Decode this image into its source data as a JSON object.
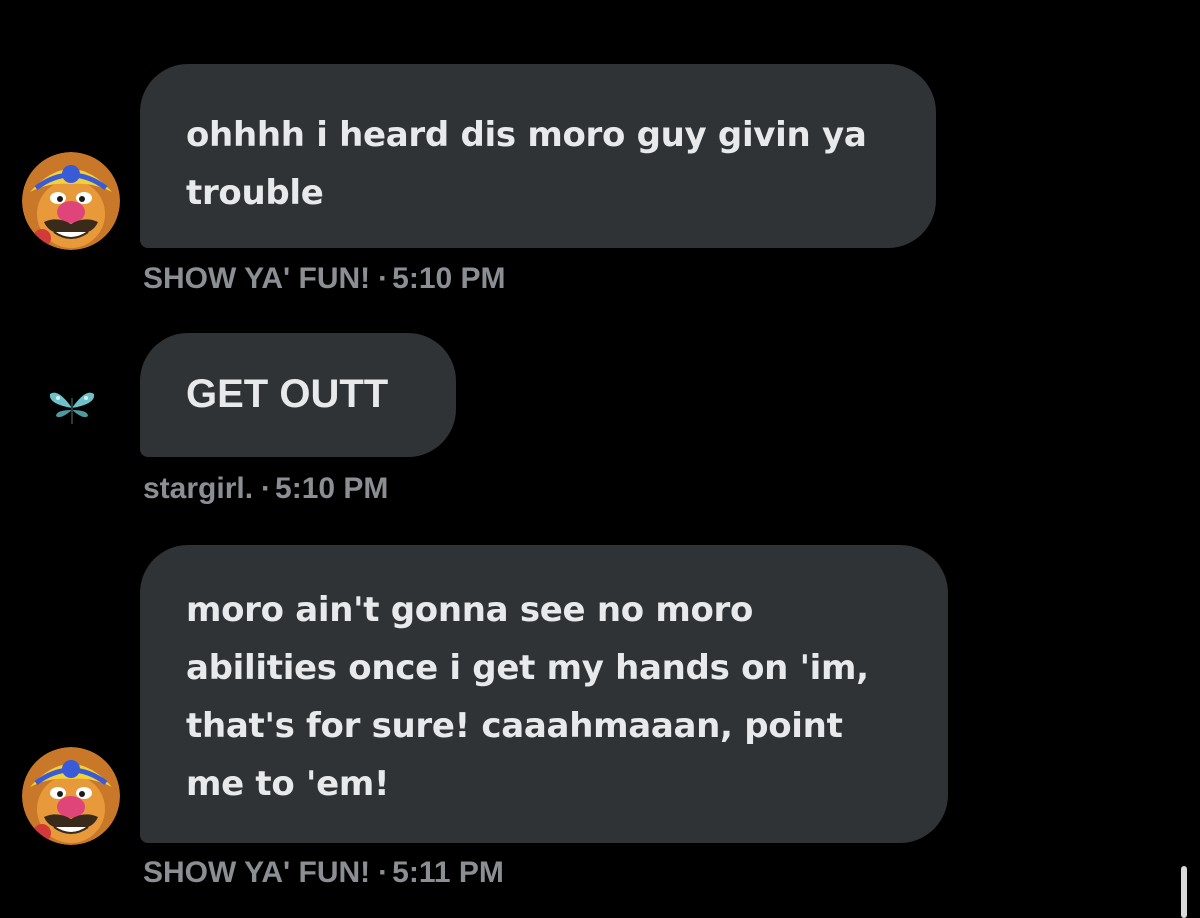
{
  "messages": [
    {
      "text": "ohhhh i heard dis moro guy givin ya trouble",
      "sender": "SHOW YA' FUN!",
      "separator": "·",
      "time": "5:10 PM",
      "avatar_icon": "wario-avatar-icon"
    },
    {
      "text": "GET OUTT",
      "sender": "stargirl.",
      "separator": "·",
      "time": "5:10 PM",
      "avatar_icon": "butterfly-avatar-icon"
    },
    {
      "text": "moro ain't gonna see no moro abilities once i get my hands on 'im, that's for sure! caaahmaaan, point me to 'em!",
      "sender": "SHOW YA' FUN!",
      "separator": "·",
      "time": "5:11 PM",
      "avatar_icon": "wario-avatar-icon"
    }
  ],
  "colors": {
    "background": "#000000",
    "bubble": "#2f3336",
    "text": "#e7e9ea",
    "meta": "#8b8e92"
  }
}
